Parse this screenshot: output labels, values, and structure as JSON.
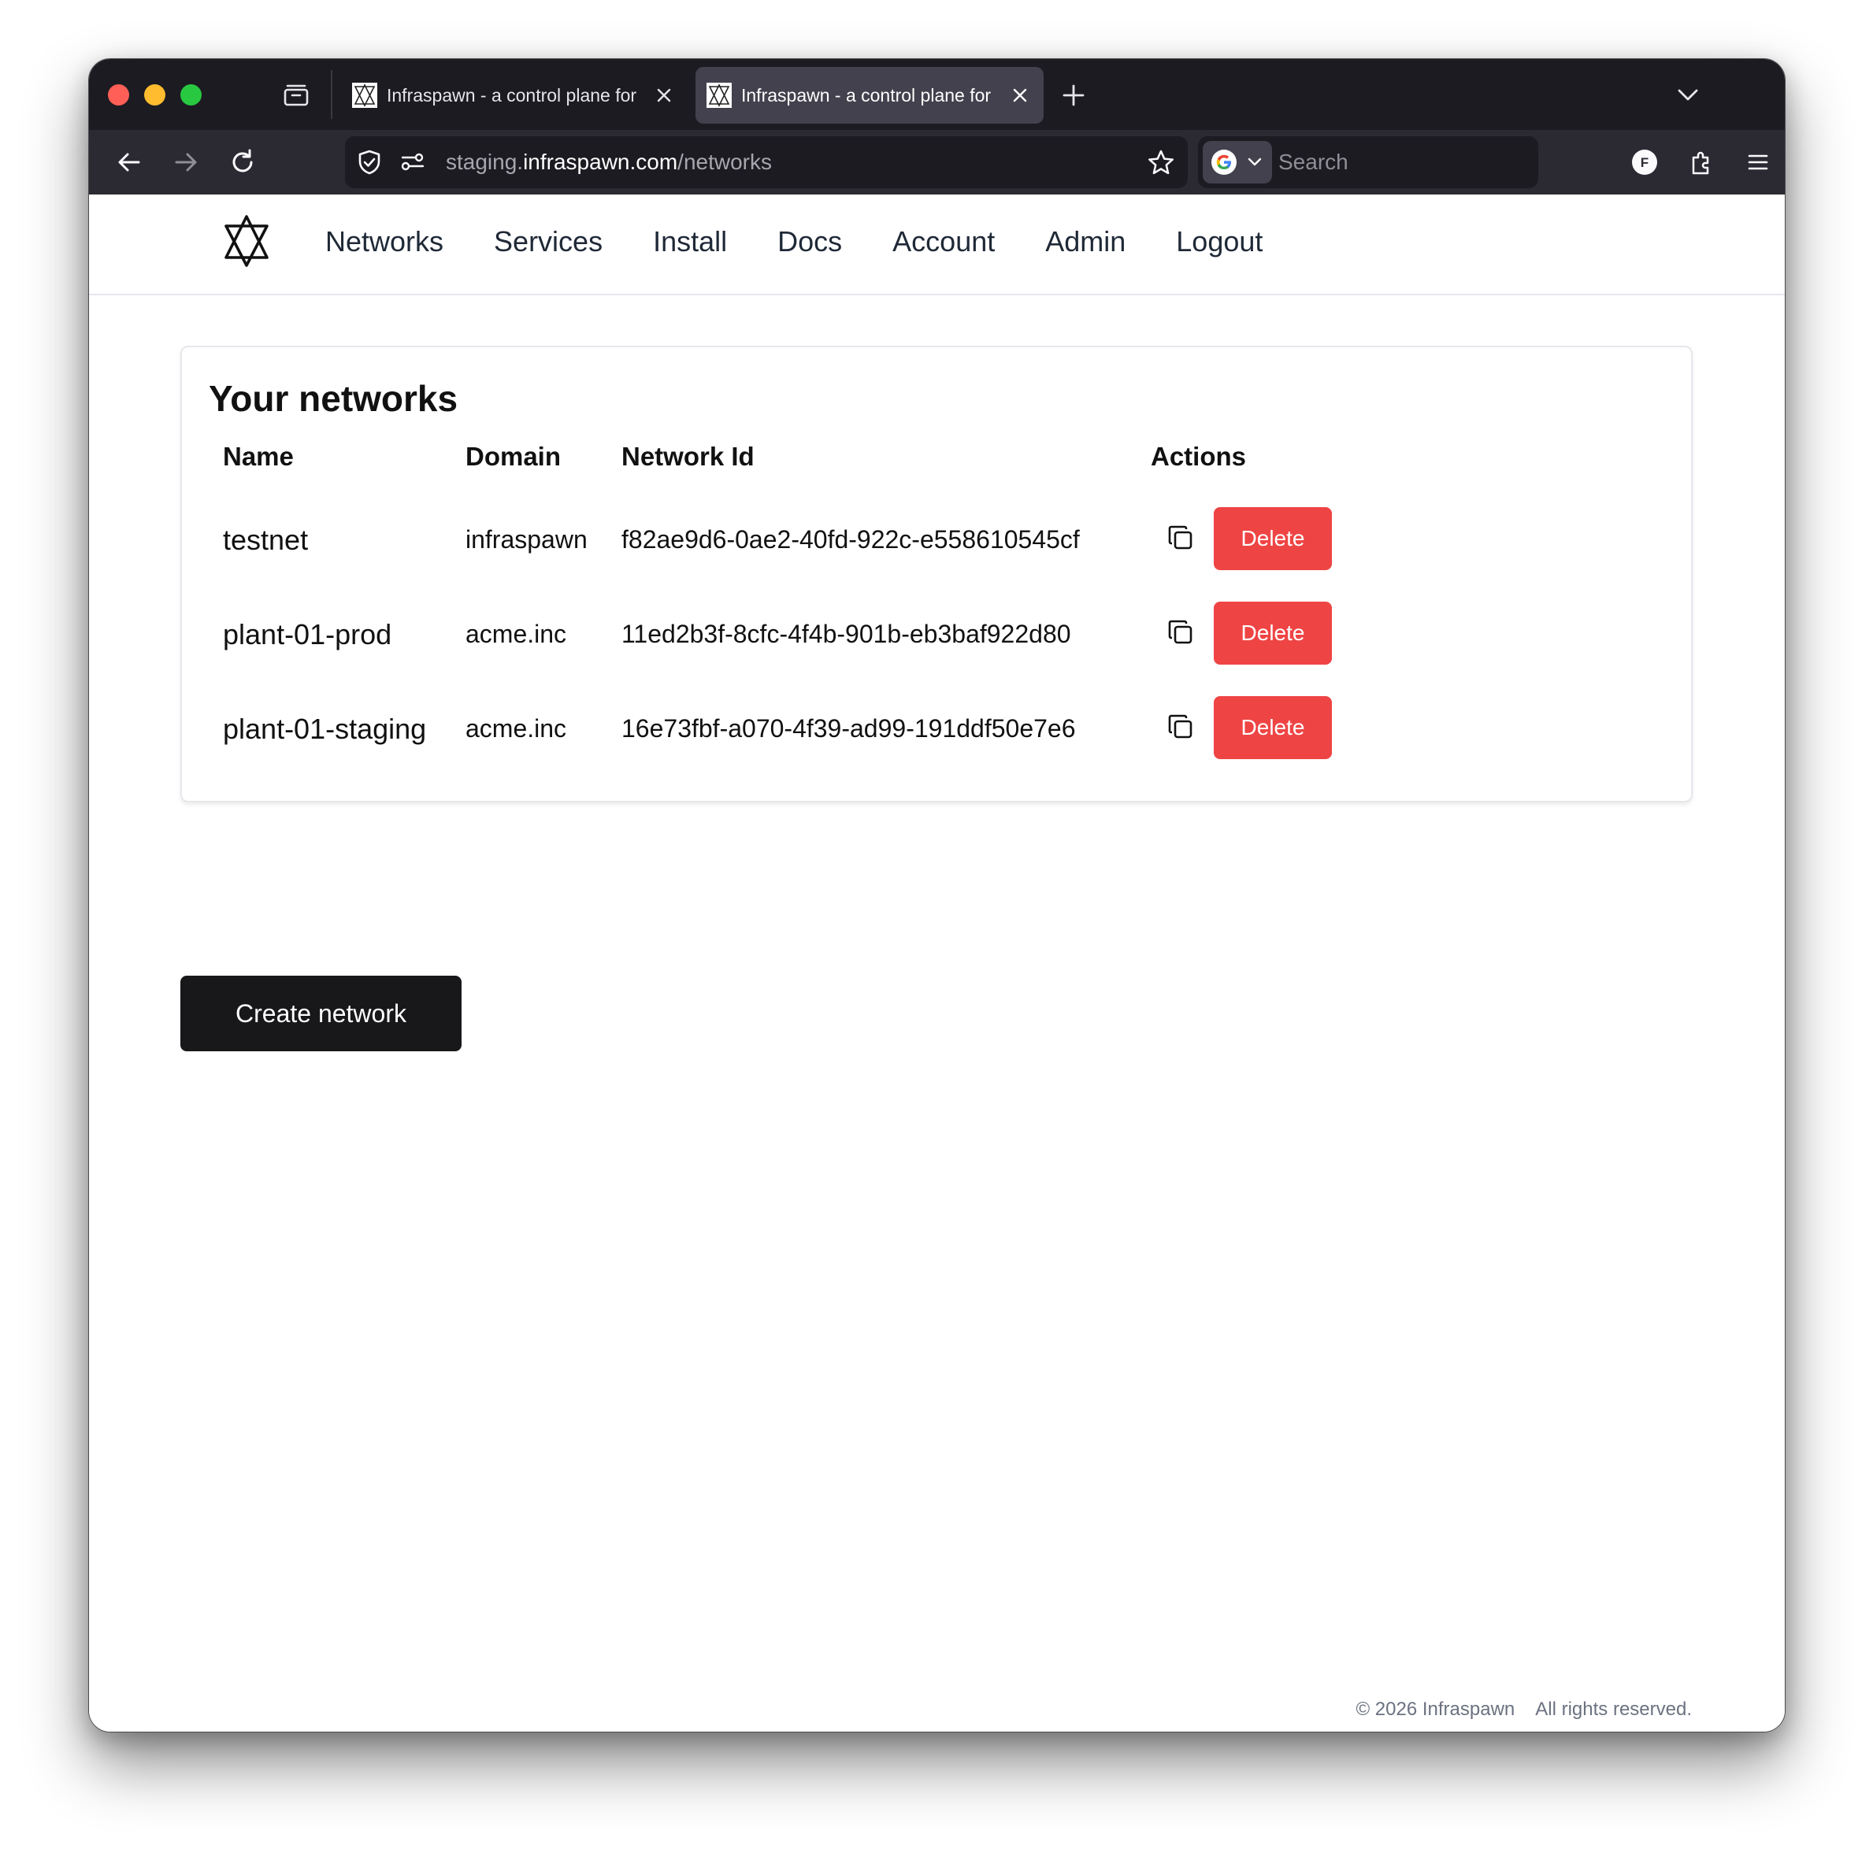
{
  "browser": {
    "tabs": [
      {
        "title": "Infraspawn - a control plane for",
        "active": false
      },
      {
        "title": "Infraspawn - a control plane for",
        "active": true
      }
    ],
    "url": {
      "sub": "staging.",
      "domain": "infraspawn.com",
      "path": "/networks"
    },
    "search_placeholder": "Search",
    "profile_initial": "F",
    "colors": {
      "frame": "#1c1b22",
      "toolbar": "#2b2a33",
      "active_tab": "#42414d"
    }
  },
  "site": {
    "logo_icon": "unicursal-hexagram-icon",
    "nav": [
      "Networks",
      "Services",
      "Install",
      "Docs",
      "Account",
      "Admin",
      "Logout"
    ]
  },
  "networks": {
    "title": "Your networks",
    "columns": [
      "Name",
      "Domain",
      "Network Id",
      "Actions"
    ],
    "rows": [
      {
        "name": "testnet",
        "domain": "infraspawn",
        "id": "f82ae9d6-0ae2-40fd-922c-e558610545cf",
        "delete_label": "Delete"
      },
      {
        "name": "plant-01-prod",
        "domain": "acme.inc",
        "id": "11ed2b3f-8cfc-4f4b-901b-eb3baf922d80",
        "delete_label": "Delete"
      },
      {
        "name": "plant-01-staging",
        "domain": "acme.inc",
        "id": "16e73fbf-a070-4f39-ad99-191ddf50e7e6",
        "delete_label": "Delete"
      }
    ],
    "create_label": "Create network",
    "colors": {
      "delete": "#ef4444",
      "create": "#18181b"
    }
  },
  "footer": {
    "copyright": "© 2026 Infraspawn",
    "rights": "All rights reserved."
  }
}
